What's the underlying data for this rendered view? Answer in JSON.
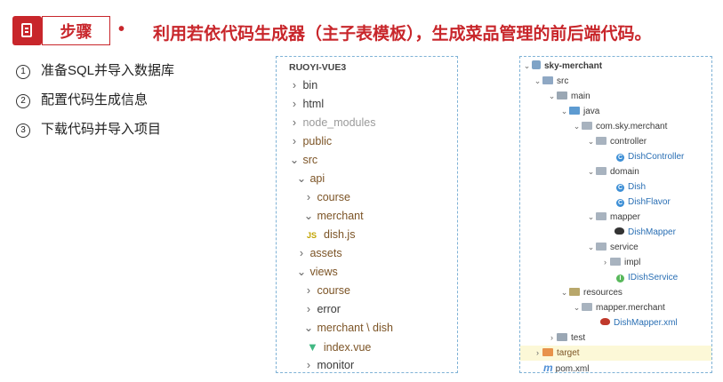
{
  "header": {
    "section_label": "步骤",
    "bullet": "•",
    "title": "利用若依代码生成器（主子表模板），生成菜品管理的前后端代码。"
  },
  "steps": [
    {
      "num": "1",
      "text": "准备SQL并导入数据库"
    },
    {
      "num": "2",
      "text": "配置代码生成信息"
    },
    {
      "num": "3",
      "text": "下载代码并导入项目"
    }
  ],
  "frontend_tree": {
    "root": "RUOYI-VUE3",
    "items": [
      {
        "label": "bin",
        "chev": "›"
      },
      {
        "label": "html",
        "chev": "›"
      },
      {
        "label": "node_modules",
        "chev": "›"
      },
      {
        "label": "public",
        "chev": "›"
      },
      {
        "label": "src",
        "chev": "⌄"
      },
      {
        "label": "api",
        "chev": "⌄"
      },
      {
        "label": "course",
        "chev": "›"
      },
      {
        "label": "merchant",
        "chev": "⌄"
      },
      {
        "label": "dish.js",
        "icon": "JS"
      },
      {
        "label": "assets",
        "chev": "›"
      },
      {
        "label": "views",
        "chev": "⌄"
      },
      {
        "label": "course",
        "chev": "›"
      },
      {
        "label": "error",
        "chev": "›"
      },
      {
        "label": "merchant \\ dish",
        "chev": "⌄"
      },
      {
        "label": "index.vue"
      },
      {
        "label": "monitor",
        "chev": "›"
      }
    ]
  },
  "backend_tree": {
    "items": [
      {
        "label": "sky-merchant"
      },
      {
        "label": "src"
      },
      {
        "label": "main"
      },
      {
        "label": "java"
      },
      {
        "label": "com.sky.merchant"
      },
      {
        "label": "controller"
      },
      {
        "label": "DishController",
        "icon": "C"
      },
      {
        "label": "domain"
      },
      {
        "label": "Dish",
        "icon": "C"
      },
      {
        "label": "DishFlavor",
        "icon": "C"
      },
      {
        "label": "mapper"
      },
      {
        "label": "DishMapper"
      },
      {
        "label": "service"
      },
      {
        "label": "impl"
      },
      {
        "label": "IDishService",
        "icon": "I"
      },
      {
        "label": "resources"
      },
      {
        "label": "mapper.merchant"
      },
      {
        "label": "DishMapper.xml"
      },
      {
        "label": "test"
      },
      {
        "label": "target"
      },
      {
        "label": "pom.xml",
        "icon": "m"
      }
    ]
  },
  "colors": {
    "accent": "#c8262b",
    "panel_border": "#7fb2d6",
    "highlight": "#fcf8d7"
  }
}
